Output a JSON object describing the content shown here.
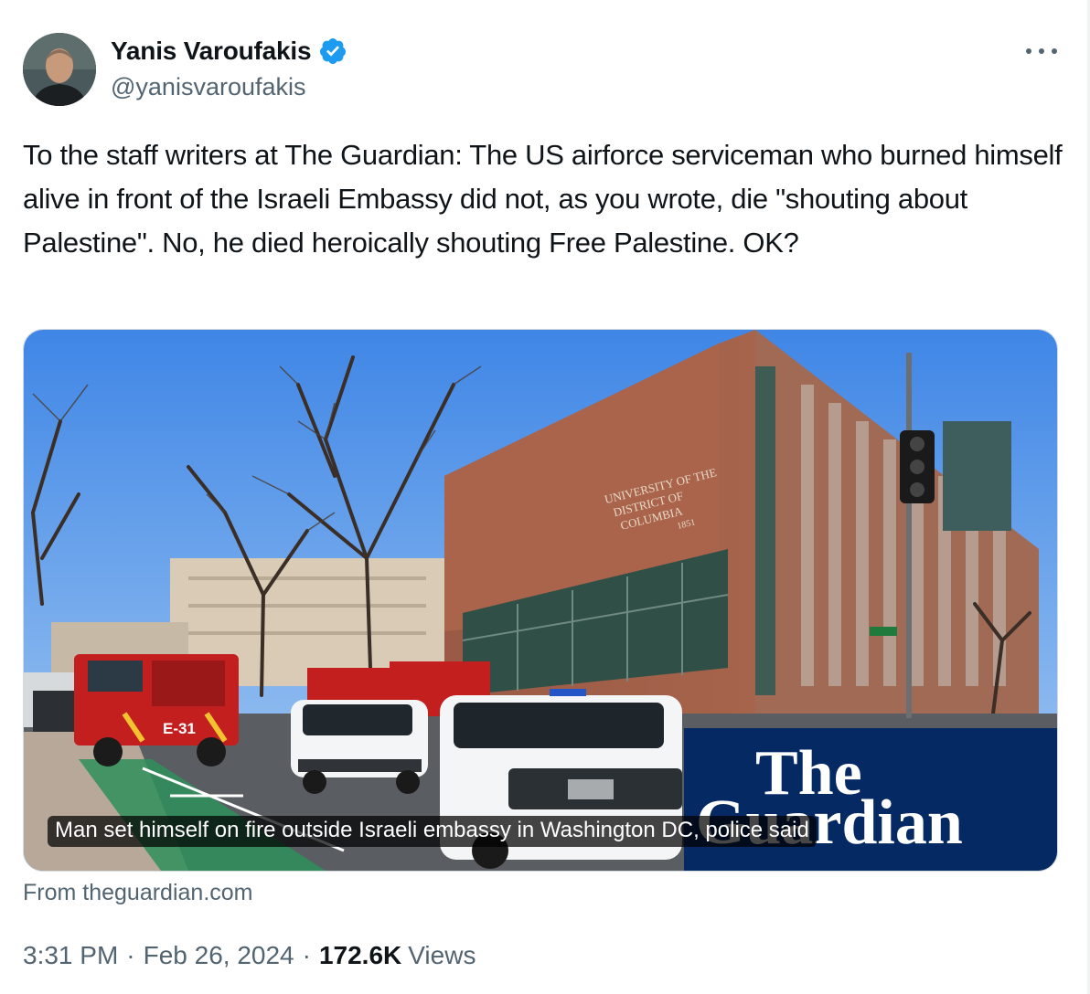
{
  "author": {
    "name": "Yanis Varoufakis",
    "handle": "@yanisvaroufakis",
    "verified": true,
    "verified_color": "#1d9bf0"
  },
  "tweet": {
    "text": "To the staff writers at The Guardian: The US airforce serviceman who burned himself alive in front of the Israeli Embassy did not, as you wrote, die \"shouting about Palestine\". No, he died heroically shouting Free Palestine. OK?"
  },
  "card": {
    "caption": "Man set himself on fire outside Israeli embassy in Washington DC, police said",
    "source": "From theguardian.com",
    "image": {
      "building_sign": [
        "UNIVERSITY OF THE",
        "DISTRICT OF",
        "COLUMBIA",
        "1851"
      ],
      "truck_label": "E-31",
      "logo_lines": [
        "The",
        "Guardian"
      ],
      "logo_bg": "#052962"
    }
  },
  "meta": {
    "time": "3:31 PM",
    "date": "Feb 26, 2024",
    "views": "172.6K",
    "views_label": "Views",
    "separator": "·"
  }
}
